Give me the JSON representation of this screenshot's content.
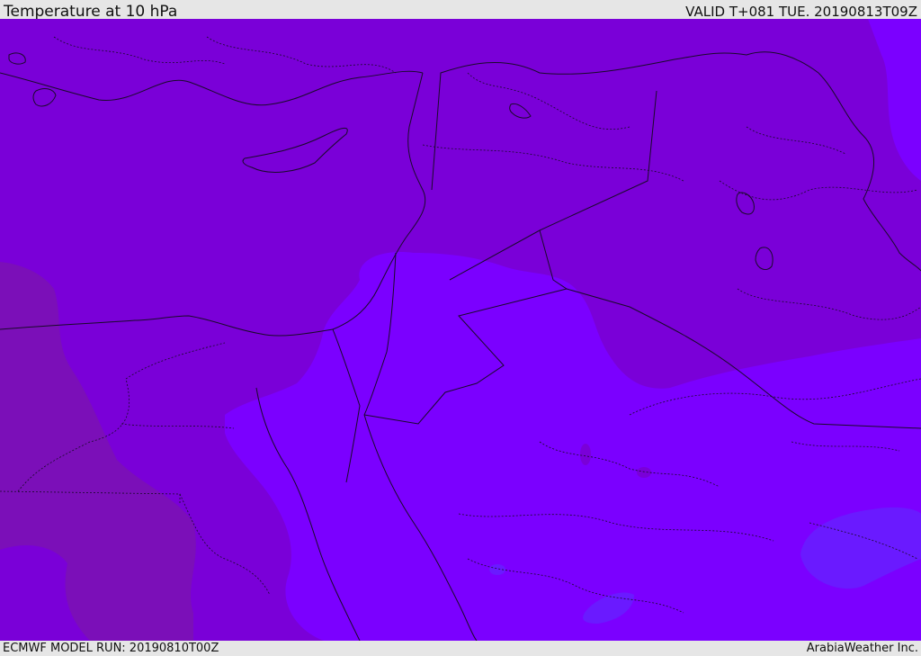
{
  "header": {
    "title": "Temperature at 10 hPa",
    "valid": "VALID T+081 TUE. 20190813T09Z"
  },
  "footer": {
    "model_run": "ECMWF MODEL RUN: 20190810T00Z",
    "credit": "ArabiaWeather Inc."
  },
  "map": {
    "colors": {
      "warm_band": "#7b0fb8",
      "mid_band": "#7a00d8",
      "cool_band": "#7b00ff",
      "cooler_patch": "#6a1aff",
      "boundary_line": "#1a0a2a"
    }
  }
}
